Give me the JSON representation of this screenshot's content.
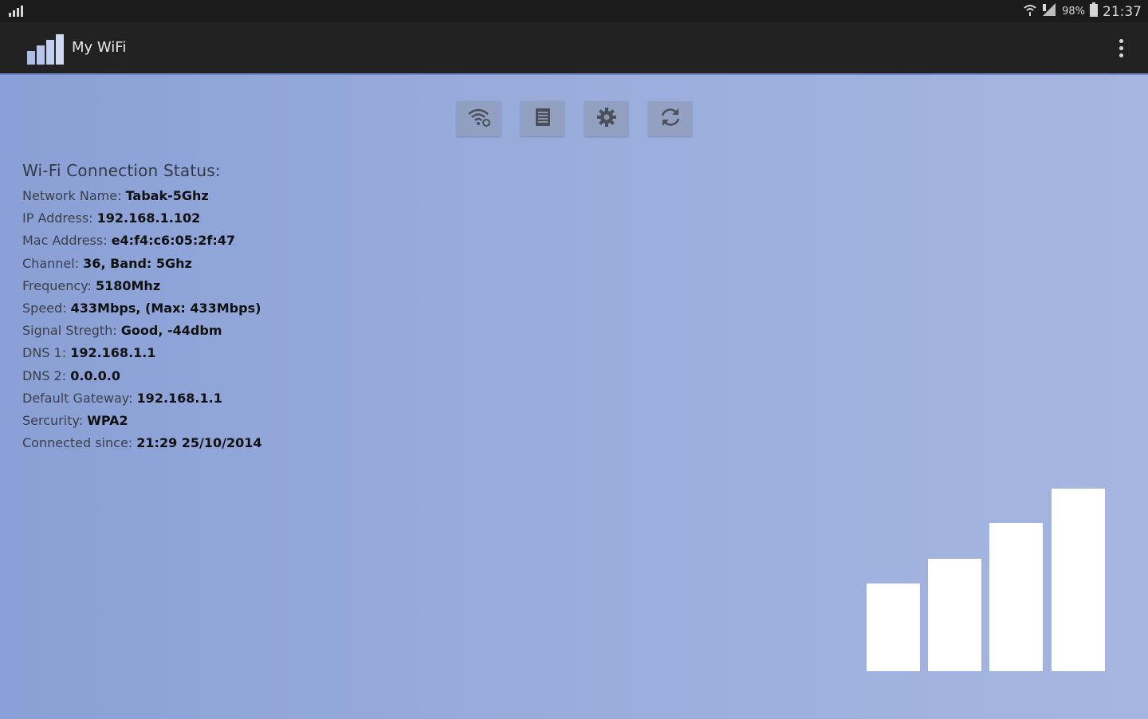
{
  "status_bar": {
    "battery_percent": "98%",
    "time": "21:37"
  },
  "app": {
    "title": "My WiFi"
  },
  "toolbar": {
    "buttons": [
      {
        "icon": "wifi-settings-icon"
      },
      {
        "icon": "document-icon"
      },
      {
        "icon": "gear-icon"
      },
      {
        "icon": "refresh-icon"
      }
    ]
  },
  "status": {
    "heading": "Wi-Fi Connection Status:",
    "rows": [
      {
        "label": "Network Name: ",
        "value": "Tabak-5Ghz"
      },
      {
        "label": "IP Address: ",
        "value": "192.168.1.102"
      },
      {
        "label": "Mac Address: ",
        "value": "e4:f4:c6:05:2f:47"
      },
      {
        "label": "Channel: ",
        "value": "36, Band: 5Ghz"
      },
      {
        "label": "Frequency: ",
        "value": "5180Mhz"
      },
      {
        "label": "Speed: ",
        "value": "433Mbps, (Max: 433Mbps)"
      },
      {
        "label": "Signal Stregth: ",
        "value": "Good, -44dbm"
      },
      {
        "label": "DNS 1: ",
        "value": "192.168.1.1"
      },
      {
        "label": "DNS 2: ",
        "value": "0.0.0.0"
      },
      {
        "label": "Default Gateway: ",
        "value": "192.168.1.1"
      },
      {
        "label": "Sercurity: ",
        "value": "WPA2"
      },
      {
        "label": "Connected since: ",
        "value": "21:29 25/10/2014"
      }
    ]
  },
  "signal_meter": {
    "level": 4,
    "max_level": 4
  },
  "colors": {
    "background_start": "#8aa0d6",
    "background_end": "#a6b6e0",
    "action_bar": "#222222",
    "bar_fill": "#ffffff"
  }
}
